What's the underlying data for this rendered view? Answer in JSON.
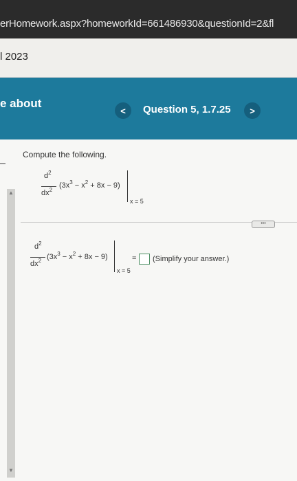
{
  "browser": {
    "url": "erHomework.aspx?homeworkId=661486930&questionId=2&fl"
  },
  "topband": {
    "term": "l 2023"
  },
  "header": {
    "left_label": "e about",
    "question_title": "Question 5, 1.7.25",
    "prev_icon": "<",
    "next_icon": ">"
  },
  "question": {
    "prompt": "Compute the following.",
    "frac_top": "d",
    "frac_top_exp": "2",
    "frac_bottom": "dx",
    "frac_bottom_exp": "2",
    "term_3x": "(3x",
    "exp3": "3",
    "term_minus_x": "− x",
    "exp2": "2",
    "term_rest": "+ 8x − 9)",
    "eval_at": "x = 5",
    "equals": "=",
    "hint": "(Simplify your answer.)",
    "more_button": "•••"
  },
  "colors": {
    "header_bg": "#1d7a9c",
    "nav_btn_bg": "#155f7d",
    "answer_border": "#4b8e62"
  }
}
